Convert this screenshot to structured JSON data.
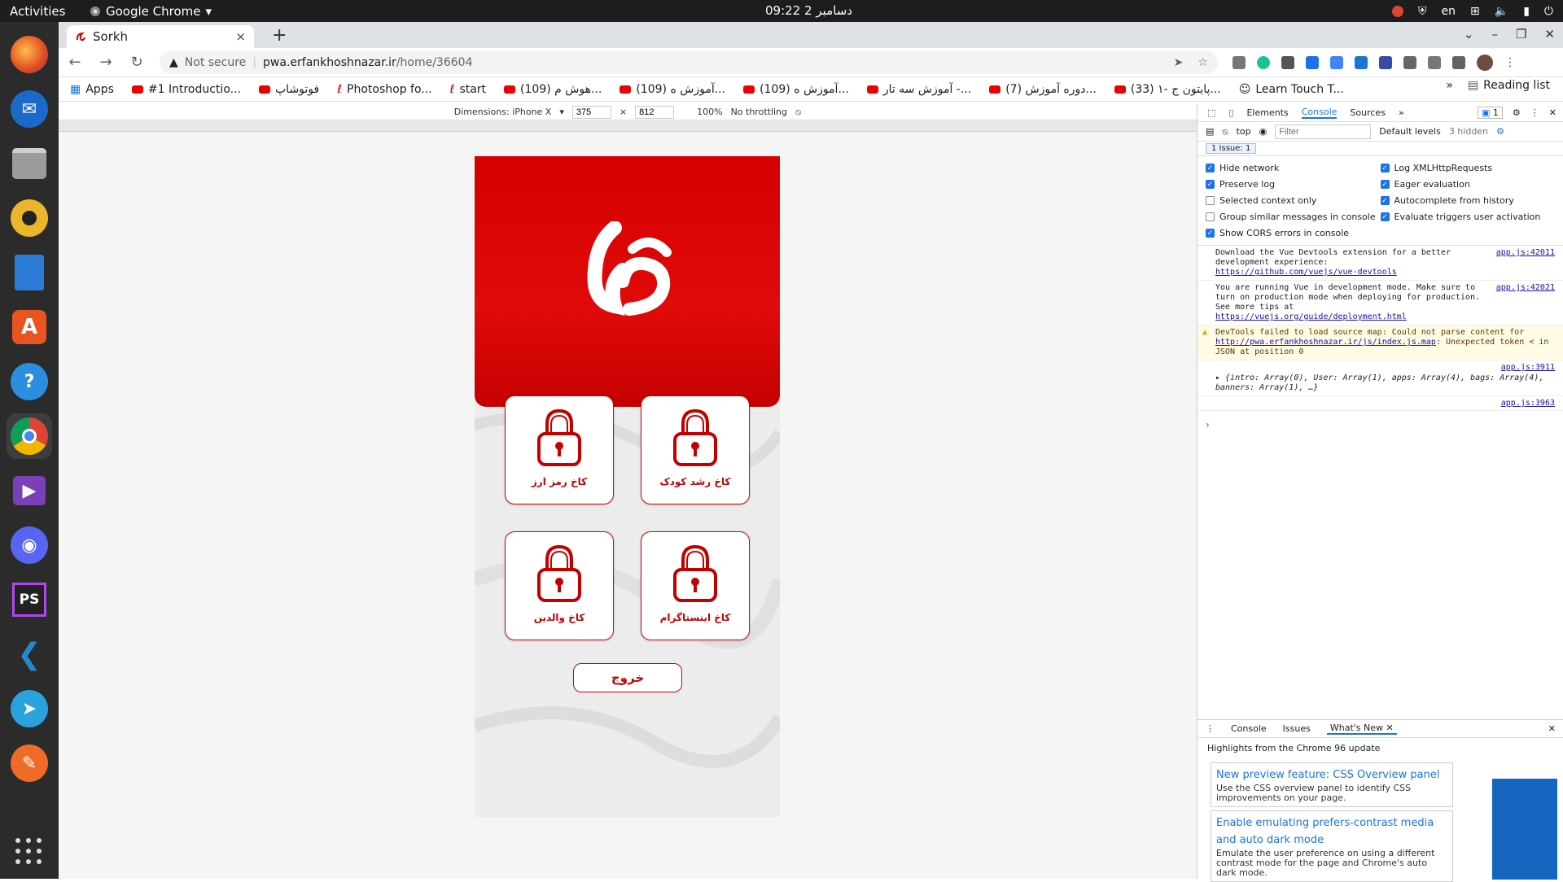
{
  "topbar": {
    "activities": "Activities",
    "app_name": "Google Chrome",
    "clock": "دسامبر 2  09:22",
    "lang": "en"
  },
  "dock": {
    "items": [
      "firefox-icon",
      "thunderbird-icon",
      "files-icon",
      "rhythmbox-icon",
      "writer-icon",
      "software-icon",
      "help-icon",
      "chrome-icon",
      "video-icon",
      "discord-icon",
      "phpstorm-icon",
      "vscode-icon",
      "telegram-icon",
      "inkscape-icon"
    ]
  },
  "tab": {
    "title": "Sorkh",
    "close": "×",
    "new": "+"
  },
  "omnibox": {
    "not_secure": "Not secure",
    "domain": "pwa.erfankhoshnazar.ir",
    "path": "/home/36604"
  },
  "bookmarks": {
    "items": [
      "Apps",
      "#1 Introductio...",
      "فوتوشاپ",
      "Photoshop fo...",
      "start",
      "(109) هوش م...",
      "(109) آموزش ه...",
      "(109) آموزش ه...",
      "آموزش سه تار -...",
      "(7) دوره آموزش...",
      "(33) ۱- پایتون ج...",
      "Learn Touch T..."
    ],
    "more": "»",
    "reading_list": "Reading list"
  },
  "device_toolbar": {
    "dimensions": "Dimensions: iPhone X",
    "width": "375",
    "height": "812",
    "x": "×",
    "zoom": "100%",
    "throttle": "No throttling"
  },
  "app": {
    "cards": [
      {
        "label": "کاخ رمز ارز"
      },
      {
        "label": "کاخ رشد کودک"
      },
      {
        "label": "کاخ والدین"
      },
      {
        "label": "کاخ اینستاگرام"
      }
    ],
    "exit": "خروج"
  },
  "devtools": {
    "tabs": [
      "Elements",
      "Console",
      "Sources"
    ],
    "more": "»",
    "badge": "1",
    "context": "top",
    "filter_placeholder": "Filter",
    "levels": "Default levels",
    "hidden": "3 hidden",
    "issue": "1 Issue:  1",
    "settings": [
      {
        "label": "Hide network",
        "on": true
      },
      {
        "label": "Log XMLHttpRequests",
        "on": true
      },
      {
        "label": "Preserve log",
        "on": true
      },
      {
        "label": "Eager evaluation",
        "on": true
      },
      {
        "label": "Selected context only",
        "on": false
      },
      {
        "label": "Autocomplete from history",
        "on": true
      },
      {
        "label": "Group similar messages in console",
        "on": false
      },
      {
        "label": "Evaluate triggers user activation",
        "on": true
      },
      {
        "label": "Show CORS errors in console",
        "on": true
      }
    ],
    "messages": [
      {
        "text": "Download the Vue Devtools extension for a better development experience:",
        "link": "https://github.com/vuejs/vue-devtools",
        "src": "app.js:42011"
      },
      {
        "text": "You are running Vue in development mode. Make sure to turn on production mode when deploying for production. See more tips at ",
        "link": "https://vuejs.org/guide/deployment.html",
        "src": "app.js:42021"
      },
      {
        "text": "DevTools failed to load source map: Could not parse content for ",
        "link": "http://pwa.erfankhoshnazar.ir/js/index.js.map",
        "tail": ": Unexpected token < in JSON at position 0"
      },
      {
        "text": "▸ {intro: Array(0), User: Array(1), apps: Array(4), bags: Array(4), banners: Array(1), …}",
        "src": "app.js:3911"
      },
      {
        "text": "",
        "src": "app.js:3963"
      }
    ],
    "prompt": "›",
    "drawer": {
      "tabs": [
        "Console",
        "Issues",
        "What's New"
      ],
      "highlight": "Highlights from the Chrome 96 update",
      "news": [
        {
          "title": "New preview feature: CSS Overview panel",
          "desc": "Use the CSS overview panel to identify CSS improvements on your page."
        },
        {
          "title": "Enable emulating prefers-contrast media and auto dark mode",
          "desc": "Emulate the user preference on using a different contrast mode for the page and Chrome's auto dark mode."
        }
      ]
    }
  }
}
